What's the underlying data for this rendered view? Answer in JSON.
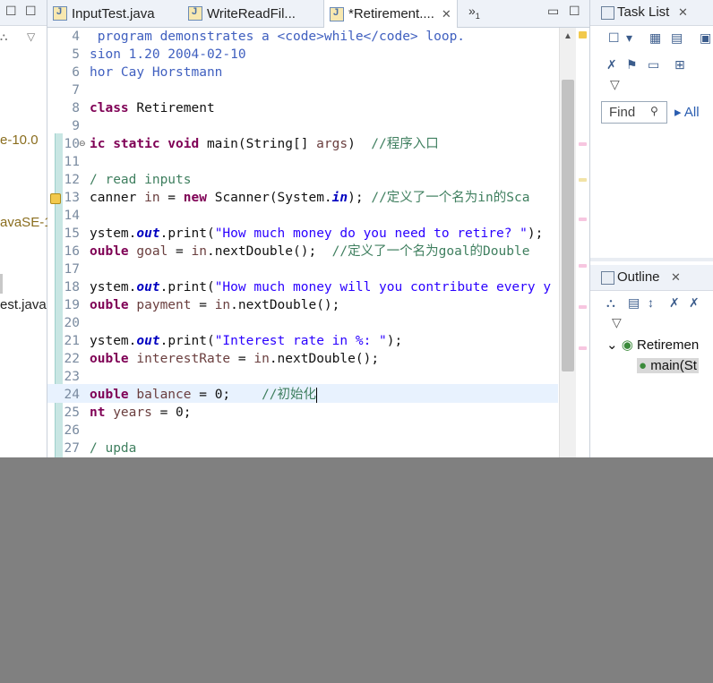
{
  "left_pane": {
    "items": [
      "e-10.0",
      "avaSE-1",
      "est.java"
    ]
  },
  "editor": {
    "tabs": [
      {
        "label": "InputTest.java",
        "active": false
      },
      {
        "label": "WriteReadFil...",
        "active": false
      },
      {
        "label": "*Retirement....",
        "active": true
      }
    ],
    "overflow": "»",
    "overflow_count": "1",
    "lines": [
      {
        "num": "4",
        "html": " <span class='jd'>program demonstrates a &lt;code&gt;while&lt;/code&gt; loop.</span>"
      },
      {
        "num": "5",
        "html": "<span class='jd'>sion 1.20 2004-02-10</span>"
      },
      {
        "num": "6",
        "html": "<span class='jd'>hor Cay Horstmann</span>"
      },
      {
        "num": "7",
        "html": ""
      },
      {
        "num": "8",
        "html": "<span class='kw'>class</span> Retirement"
      },
      {
        "num": "9",
        "html": ""
      },
      {
        "num": "10",
        "html": "<span class='kw'>ic static void</span> main(String[] <span class='var'>args</span>)  <span class='cm'>//程序入口</span>"
      },
      {
        "num": "11",
        "html": ""
      },
      {
        "num": "12",
        "html": "<span class='cm'>/ read inputs</span>"
      },
      {
        "num": "13",
        "html": "canner <span class='var'>in</span> = <span class='kw'>new</span> Scanner(System.<span class='fld'>in</span>); <span class='cm'>//定义了一个名为in的Sca</span>"
      },
      {
        "num": "14",
        "html": ""
      },
      {
        "num": "15",
        "html": "ystem.<span class='fld'>out</span>.print(<span class='st'>\"How much money do you need to retire? \"</span>);"
      },
      {
        "num": "16",
        "html": "<span class='kw'>ouble</span> <span class='var'>goal</span> = <span class='var'>in</span>.nextDouble();  <span class='cm'>//定义了一个名为goal的Double</span>"
      },
      {
        "num": "17",
        "html": ""
      },
      {
        "num": "18",
        "html": "ystem.<span class='fld'>out</span>.print(<span class='st'>\"How much money will you contribute every y</span>"
      },
      {
        "num": "19",
        "html": "<span class='kw'>ouble</span> <span class='var'>payment</span> = <span class='var'>in</span>.nextDouble();"
      },
      {
        "num": "20",
        "html": ""
      },
      {
        "num": "21",
        "html": "ystem.<span class='fld'>out</span>.print(<span class='st'>\"Interest rate in %: \"</span>);"
      },
      {
        "num": "22",
        "html": "<span class='kw'>ouble</span> <span class='var'>interestRate</span> = <span class='var'>in</span>.nextDouble();"
      },
      {
        "num": "23",
        "html": ""
      },
      {
        "num": "24",
        "html": "<span class='kw'>ouble</span> <span class='var'>balance</span> = 0;    <span class='cm'>//初始化</span><span class='caret'></span>"
      },
      {
        "num": "25",
        "html": "<span class='kw'>nt</span> <span class='var'>years</span> = 0;"
      },
      {
        "num": "26",
        "html": ""
      },
      {
        "num": "27",
        "html": "<span class='cm'>/ upda</span>"
      }
    ]
  },
  "task_list": {
    "title": "Task List",
    "find_placeholder": "Find",
    "all_label": "All"
  },
  "outline": {
    "title": "Outline",
    "class_label": "Retiremen",
    "method_label": "main(St"
  }
}
